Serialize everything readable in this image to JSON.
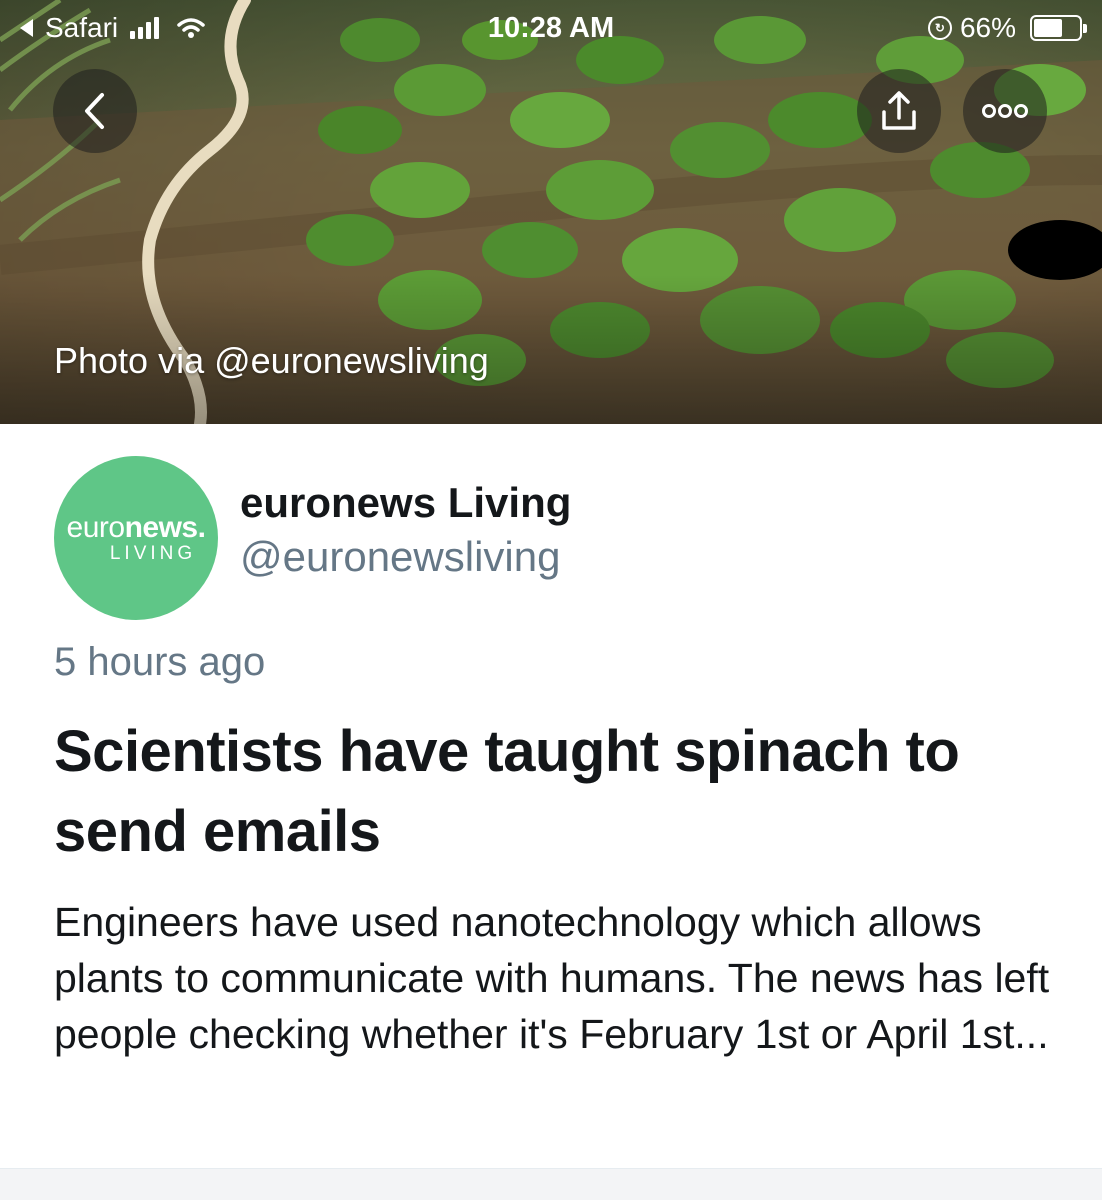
{
  "status_bar": {
    "back_app": "Safari",
    "time": "10:28 AM",
    "battery_percent": "66%",
    "battery_level": 0.66,
    "signal_bars": 4
  },
  "hero": {
    "photo_credit": "Photo via @euronewsliving"
  },
  "author": {
    "name": "euronews Living",
    "handle": "@euronewsliving",
    "avatar": {
      "logo_light": "euro",
      "logo_bold": "news.",
      "logo_sub": "LIVING",
      "color": "#5fc687"
    }
  },
  "article": {
    "timestamp": "5 hours ago",
    "headline": "Scientists have taught spinach to send emails",
    "summary": "Engineers have used nanotechnology which allows plants to communicate with humans. The news has left people checking whether it's February 1st or April 1st..."
  },
  "icons": {
    "back": "chevron-left-icon",
    "share": "share-icon",
    "more": "more-icon"
  },
  "colors": {
    "text": "#14171a",
    "secondary_text": "#657786",
    "avatar_green": "#5fc687"
  }
}
